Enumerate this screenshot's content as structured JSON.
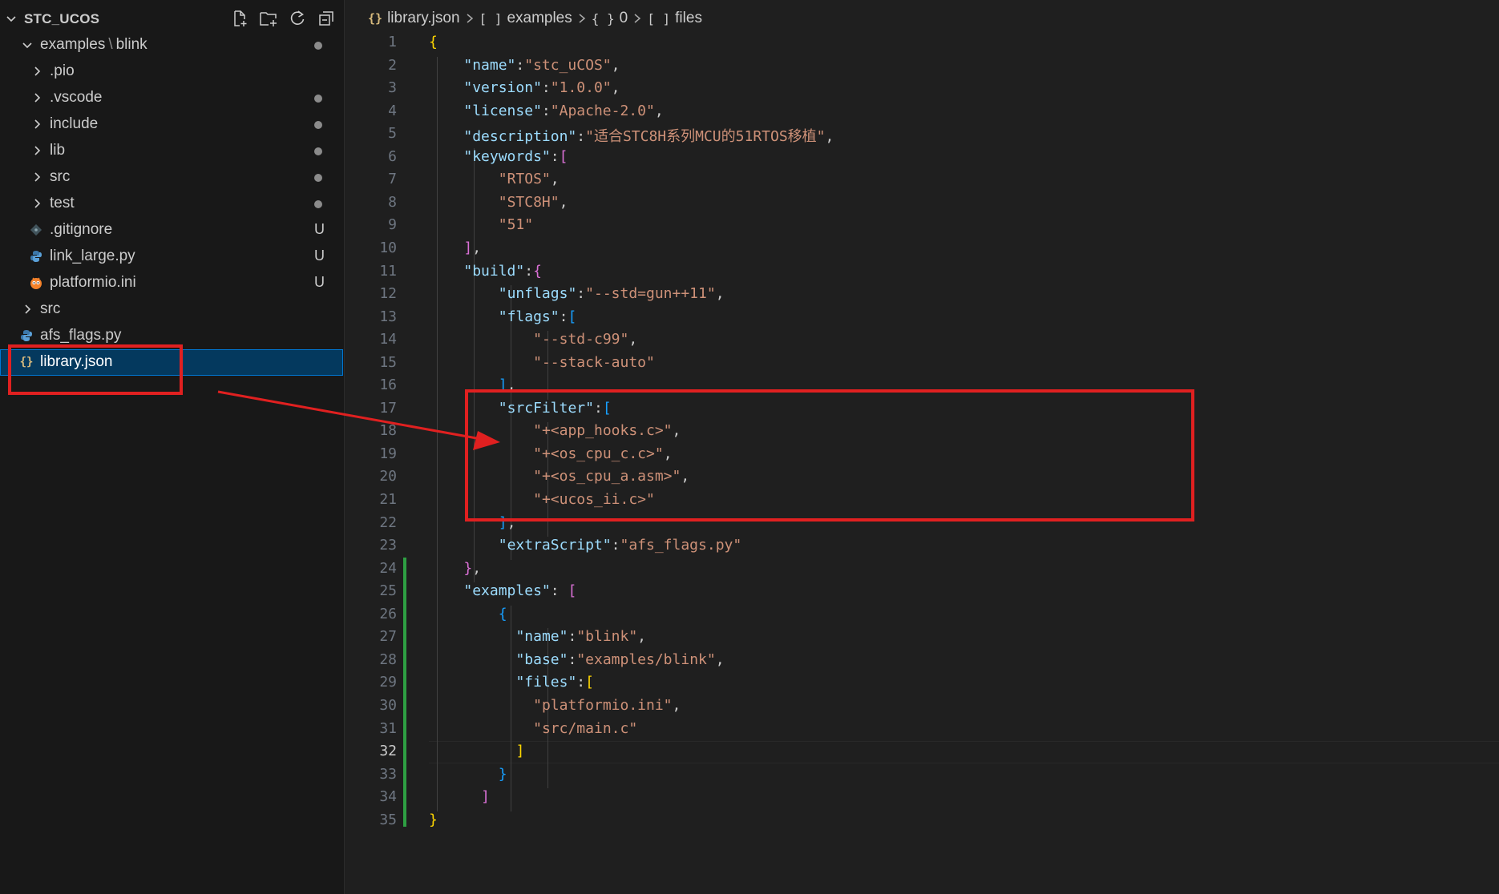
{
  "explorer": {
    "title": "STC_UCOS",
    "actions": [
      {
        "name": "new-file-icon"
      },
      {
        "name": "new-folder-icon"
      },
      {
        "name": "refresh-icon"
      },
      {
        "name": "collapse-all-icon"
      }
    ],
    "items": [
      {
        "id": "examples",
        "type": "folder-open",
        "label": "examples",
        "label2": "blink",
        "status": "dot"
      },
      {
        "id": "pio",
        "type": "folder",
        "label": ".pio",
        "status": ""
      },
      {
        "id": "vscode",
        "type": "folder",
        "label": ".vscode",
        "status": "dot"
      },
      {
        "id": "include",
        "type": "folder",
        "label": "include",
        "status": "dot"
      },
      {
        "id": "lib",
        "type": "folder",
        "label": "lib",
        "status": "dot"
      },
      {
        "id": "src-inner",
        "type": "folder",
        "label": "src",
        "status": "dot"
      },
      {
        "id": "test",
        "type": "folder",
        "label": "test",
        "status": "dot"
      },
      {
        "id": "gitignore",
        "type": "file",
        "label": ".gitignore",
        "icon": "git-icon",
        "status": "U"
      },
      {
        "id": "link-large",
        "type": "file",
        "label": "link_large.py",
        "icon": "python-icon",
        "status": "U"
      },
      {
        "id": "platformio",
        "type": "file",
        "label": "platformio.ini",
        "icon": "platformio-icon",
        "status": "U"
      },
      {
        "id": "src",
        "type": "folder",
        "label": "src",
        "status": ""
      },
      {
        "id": "afs-flags",
        "type": "file",
        "label": "afs_flags.py",
        "icon": "python-icon",
        "status": ""
      },
      {
        "id": "library-json",
        "type": "file",
        "label": "library.json",
        "icon": "json-icon",
        "status": "",
        "selected": true
      }
    ]
  },
  "breadcrumb": {
    "file": "library.json",
    "segments": [
      "examples",
      "0",
      "files"
    ]
  },
  "editor": {
    "active_line": 32,
    "lines": [
      "{",
      "    \"name\":\"stc_uCOS\",",
      "    \"version\":\"1.0.0\",",
      "    \"license\":\"Apache-2.0\",",
      "    \"description\":\"适合STC8H系列MCU的51RTOS移植\",",
      "    \"keywords\":[",
      "        \"RTOS\",",
      "        \"STC8H\",",
      "        \"51\"",
      "    ],",
      "    \"build\":{",
      "        \"unflags\":\"--std=gun++11\",",
      "        \"flags\":[",
      "            \"--std-c99\",",
      "            \"--stack-auto\"",
      "        ],",
      "        \"srcFilter\":[",
      "            \"+<app_hooks.c>\",",
      "            \"+<os_cpu_c.c>\",",
      "            \"+<os_cpu_a.asm>\",",
      "            \"+<ucos_ii.c>\"",
      "        ],",
      "        \"extraScript\":\"afs_flags.py\"",
      "    },",
      "    \"examples\": [",
      "        {",
      "          \"name\":\"blink\",",
      "          \"base\":\"examples/blink\",",
      "          \"files\":[",
      "            \"platformio.ini\",",
      "            \"src/main.c\"",
      "          ]",
      "        }",
      "      ]",
      "}"
    ]
  },
  "colors": {
    "key": "#9cdcfe",
    "string": "#ce9178",
    "bracket1": "#ffd700",
    "bracket2": "#da70d6",
    "bracket3": "#179fff",
    "annotation": "#e02020",
    "selection": "#04395e"
  }
}
